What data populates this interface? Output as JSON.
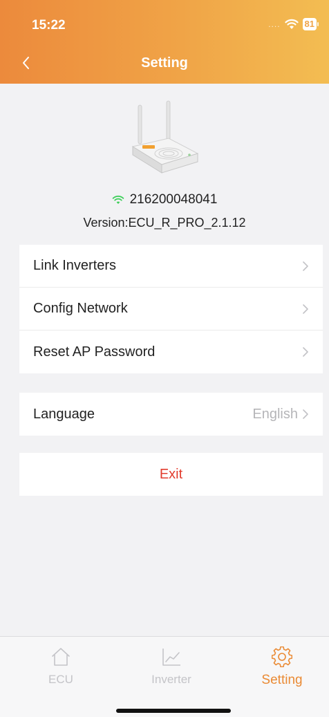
{
  "status_bar": {
    "time": "15:22",
    "battery": "81"
  },
  "nav": {
    "title": "Setting"
  },
  "device": {
    "serial": "216200048041",
    "version": "Version:ECU_R_PRO_2.1.12"
  },
  "menu": {
    "items": [
      {
        "label": "Link Inverters"
      },
      {
        "label": "Config Network"
      },
      {
        "label": "Reset AP Password"
      }
    ]
  },
  "language": {
    "label": "Language",
    "value": "English"
  },
  "exit": {
    "label": "Exit"
  },
  "tabs": [
    {
      "label": "ECU",
      "icon": "home-icon"
    },
    {
      "label": "Inverter",
      "icon": "chart-icon"
    },
    {
      "label": "Setting",
      "icon": "gear-icon",
      "active": true
    }
  ],
  "colors": {
    "accent": "#ea8a34",
    "exit": "#e23c2e",
    "wifi": "#3ecf5a"
  }
}
